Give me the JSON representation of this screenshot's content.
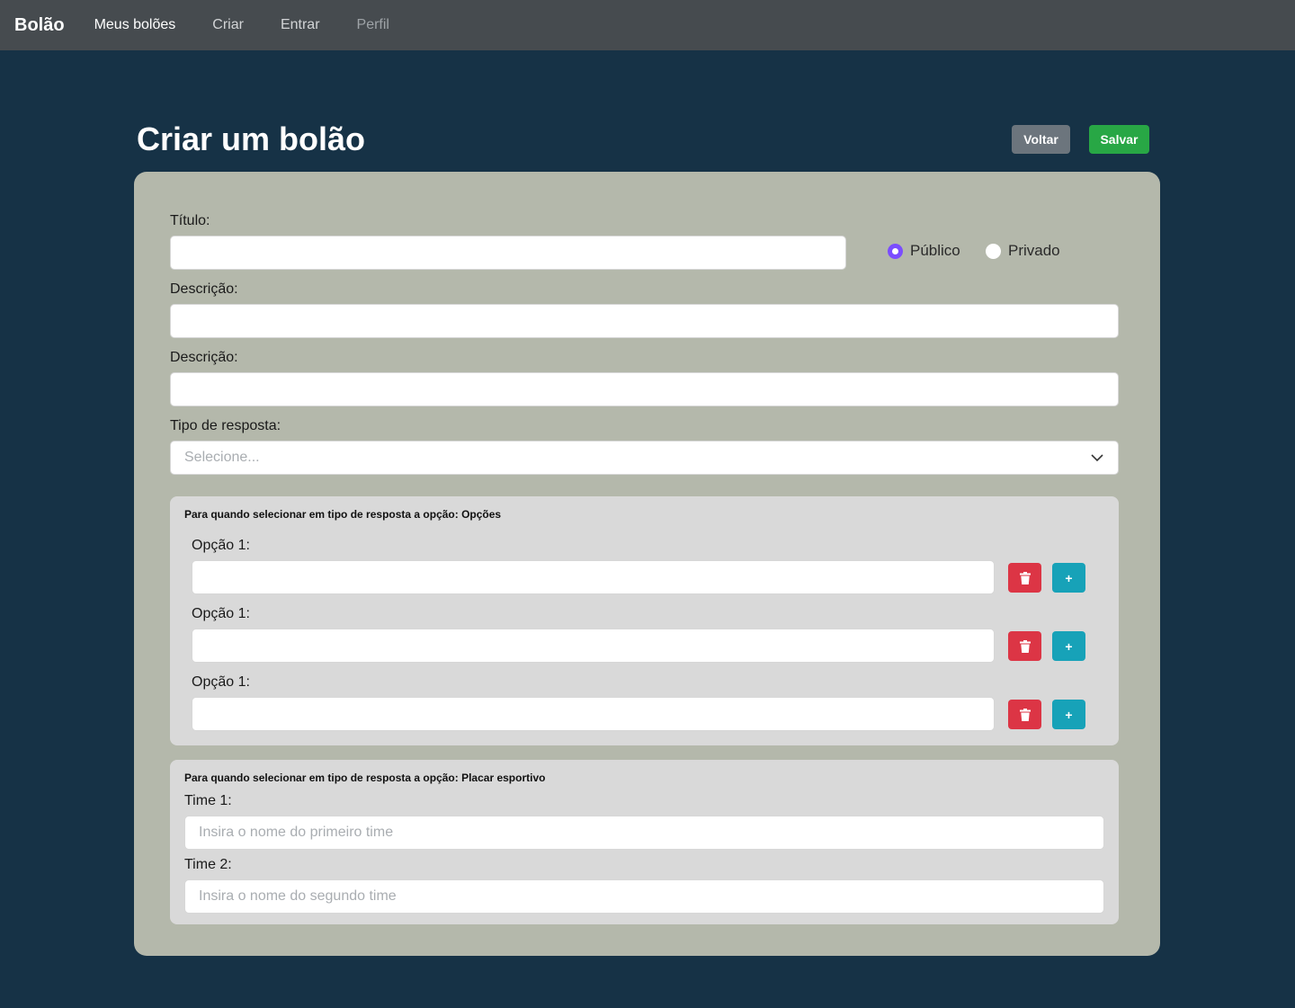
{
  "navbar": {
    "brand": "Bolão",
    "links": [
      "Meus bolões",
      "Criar",
      "Entrar",
      "Perfil"
    ]
  },
  "page": {
    "title": "Criar um bolão",
    "back_label": "Voltar",
    "save_label": "Salvar"
  },
  "form": {
    "title_label": "Título:",
    "visibility": {
      "public_label": "Público",
      "private_label": "Privado",
      "selected": "Público"
    },
    "description_label": "Descrição:",
    "description2_label": "Descrição:",
    "response_type_label": "Tipo de resposta:",
    "response_type_placeholder": "Selecione..."
  },
  "options_panel": {
    "note": "Para quando selecionar em tipo de resposta a opção: Opções",
    "options": [
      {
        "label": "Opção 1:",
        "value": ""
      },
      {
        "label": "Opção 1:",
        "value": ""
      },
      {
        "label": "Opção 1:",
        "value": ""
      }
    ],
    "add_label": "+"
  },
  "score_panel": {
    "note": "Para quando selecionar em tipo de resposta a opção: Placar esportivo",
    "team1_label": "Time 1:",
    "team1_placeholder": "Insira o nome do primeiro time",
    "team2_label": "Time 2:",
    "team2_placeholder": "Insira o nome do segundo time"
  },
  "colors": {
    "navbar": "#464b4f",
    "background": "#163246",
    "card": "#b4b8ab",
    "panel": "#d9d9d9",
    "danger": "#dc3545",
    "info": "#17a2b8",
    "success": "#28a745",
    "secondary": "#6c757d",
    "radio_accent": "#7b4dff"
  }
}
